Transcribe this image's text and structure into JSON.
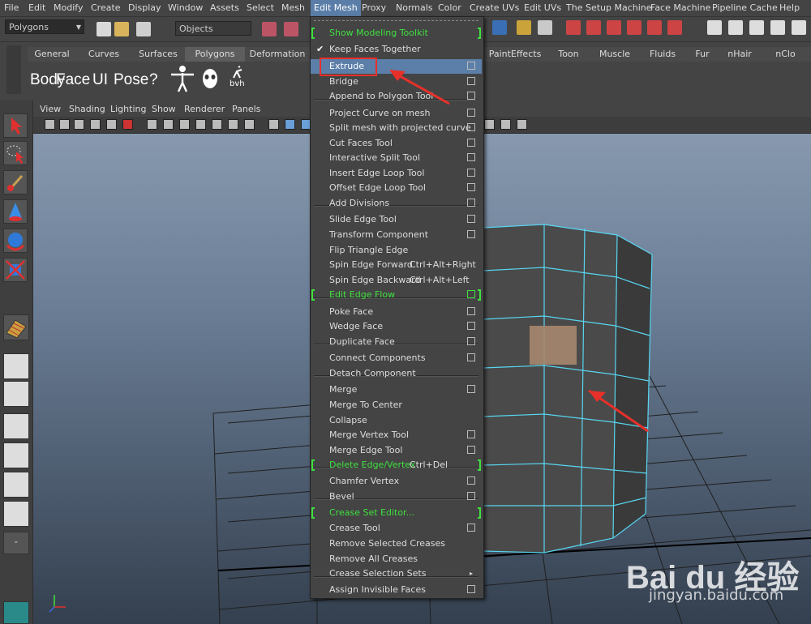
{
  "menubar": [
    "File",
    "Edit",
    "Modify",
    "Create",
    "Display",
    "Window",
    "Assets",
    "Select",
    "Mesh",
    "Edit Mesh",
    "Proxy",
    "Normals",
    "Color",
    "Create UVs",
    "Edit UVs",
    "The Setup Machine",
    "Face Machine",
    "Pipeline Cache",
    "Help"
  ],
  "status": {
    "menu_set": "Polygons",
    "selection_mode": "Objects"
  },
  "shelf": {
    "tabs": [
      "General",
      "Curves",
      "Surfaces",
      "Polygons",
      "Deformation",
      "PaintEffects",
      "Toon",
      "Muscle",
      "Fluids",
      "Fur",
      "nHair",
      "nClo"
    ],
    "buttons": [
      "Body",
      "Face",
      "UI",
      "Pose",
      "?",
      "bvh"
    ]
  },
  "panel_menu": [
    "View",
    "Shading",
    "Lighting",
    "Show",
    "Renderer",
    "Panels"
  ],
  "edit_mesh_menu": [
    {
      "label": "Show Modeling Toolkit",
      "green": true,
      "box": false,
      "brackets": true
    },
    {
      "label": "Keep Faces Together",
      "check": true,
      "box": false
    },
    {
      "label": "Extrude",
      "box": true,
      "highlighted": true
    },
    {
      "label": "Bridge",
      "box": true
    },
    {
      "label": "Append to Polygon Tool",
      "box": true
    },
    {
      "label": "Project Curve on mesh",
      "box": true
    },
    {
      "label": "Split mesh with projected curve",
      "box": true
    },
    {
      "label": "Cut Faces Tool",
      "box": true
    },
    {
      "label": "Interactive Split Tool",
      "box": true
    },
    {
      "label": "Insert Edge Loop Tool",
      "box": true
    },
    {
      "label": "Offset Edge Loop Tool",
      "box": true
    },
    {
      "label": "Add Divisions",
      "box": true
    },
    {
      "label": "Slide Edge Tool",
      "box": true
    },
    {
      "label": "Transform Component",
      "box": true
    },
    {
      "label": "Flip Triangle Edge",
      "box": false
    },
    {
      "label": "Spin Edge Forward",
      "shortcut": "Ctrl+Alt+Right",
      "box": false
    },
    {
      "label": "Spin Edge Backward",
      "shortcut": "Ctrl+Alt+Left",
      "box": false
    },
    {
      "label": "Edit Edge Flow",
      "green": true,
      "box": true,
      "brackets": true
    },
    {
      "label": "Poke Face",
      "box": true
    },
    {
      "label": "Wedge Face",
      "box": true
    },
    {
      "label": "Duplicate Face",
      "box": true
    },
    {
      "label": "Connect Components",
      "box": true
    },
    {
      "label": "Detach Component",
      "box": false
    },
    {
      "label": "Merge",
      "box": true
    },
    {
      "label": "Merge To Center",
      "box": false
    },
    {
      "label": "Collapse",
      "box": false
    },
    {
      "label": "Merge Vertex Tool",
      "box": true
    },
    {
      "label": "Merge Edge Tool",
      "box": true
    },
    {
      "label": "Delete Edge/Vertex",
      "shortcut": "Ctrl+Del",
      "green": true,
      "box": false,
      "brackets": true
    },
    {
      "label": "Chamfer Vertex",
      "box": true
    },
    {
      "label": "Bevel",
      "box": true
    },
    {
      "label": "Crease Set Editor...",
      "green": true,
      "box": false,
      "brackets": true
    },
    {
      "label": "Crease Tool",
      "box": true
    },
    {
      "label": "Remove Selected Creases",
      "box": false
    },
    {
      "label": "Remove All Creases",
      "box": false
    },
    {
      "label": "Crease Selection Sets",
      "box": false,
      "submenu": true
    },
    {
      "label": "Assign Invisible Faces",
      "box": true
    }
  ],
  "watermark": {
    "brand": "Bai du 经验",
    "url": "jingyan.baidu.com"
  },
  "colors": {
    "highlight": "#5b7fa8",
    "annotation": "#e8302a",
    "wire": "#58d6f0",
    "green_text": "#3fe03f"
  }
}
